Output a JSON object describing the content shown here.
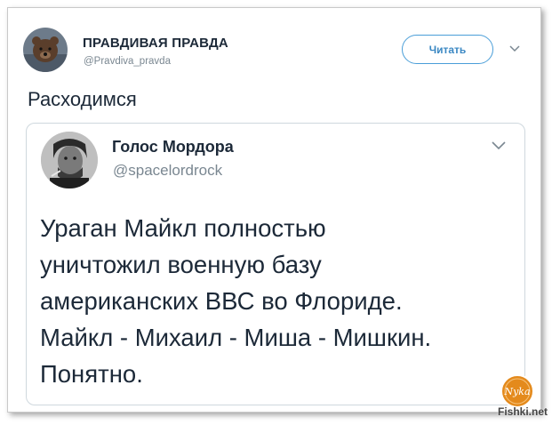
{
  "tweet": {
    "author_name": "ПРАВДИВАЯ ПРАВДА",
    "author_handle": "@Pravdiva_pravda",
    "follow_label": "Читать",
    "text": "Расходимся"
  },
  "quoted_tweet": {
    "author_name": "Голос Мордора",
    "author_handle": "@spacelordrock",
    "lines": [
      "Ураган Майкл полностью",
      "уничтожил военную базу",
      "американских ВВС во Флориде.",
      "Майкл - Михаил - Миша - Мишкин.",
      "Понятно."
    ]
  },
  "watermark": {
    "site": "Fishki.net",
    "badge_text": "Nyka"
  },
  "colors": {
    "text_primary": "#1c2938",
    "text_secondary": "#7a8791",
    "accent_blue": "#3b88c3",
    "badge_orange": "#e48a1c"
  },
  "icons": {
    "avatar": "bear-avatar",
    "quoted_avatar": "man-avatar",
    "menu": "chevron-down-icon"
  }
}
